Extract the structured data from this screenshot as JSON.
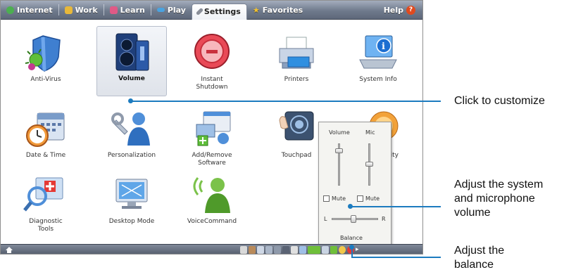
{
  "tabs": [
    {
      "label": "Internet",
      "color": "#4caf50"
    },
    {
      "label": "Work",
      "color": "#e8b83a"
    },
    {
      "label": "Learn",
      "color": "#e05a86"
    },
    {
      "label": "Play",
      "color": "#4aa3e0"
    },
    {
      "label": "Settings",
      "color": "#8a8f99",
      "active": true
    },
    {
      "label": "Favorites",
      "color": "#f4c430"
    }
  ],
  "help_label": "Help",
  "apps": [
    {
      "label": "Anti-Virus",
      "icon": "shield-icon"
    },
    {
      "label": "Volume",
      "icon": "speaker-icon",
      "selected": true
    },
    {
      "label": "Instant\nShutdown",
      "icon": "power-icon"
    },
    {
      "label": "Printers",
      "icon": "printer-icon"
    },
    {
      "label": "System Info",
      "icon": "laptop-info-icon"
    },
    {
      "label": "Date & Time",
      "icon": "clock-calendar-icon"
    },
    {
      "label": "Personalization",
      "icon": "user-wrench-icon"
    },
    {
      "label": "Add/Remove\nSoftware",
      "icon": "software-icon"
    },
    {
      "label": "Touchpad",
      "icon": "touchpad-icon"
    },
    {
      "label": "lity",
      "icon": "accessibility-icon"
    },
    {
      "label": "Diagnostic\nTools",
      "icon": "diagnostic-icon"
    },
    {
      "label": "Desktop Mode",
      "icon": "desktop-icon"
    },
    {
      "label": "VoiceCommand",
      "icon": "voice-icon"
    }
  ],
  "mixer": {
    "volume_label": "Volume",
    "mic_label": "Mic",
    "mute_label_1": "Mute",
    "mute_label_2": "Mute",
    "balance_left": "L",
    "balance_right": "R",
    "balance_label": "Balance"
  },
  "callouts": {
    "customize": "Click to customize",
    "adjust_volume": "Adjust the system\nand microphone\nvolume",
    "adjust_balance": "Adjust the\nbalance"
  },
  "colors": {
    "accent": "#1c7bbf"
  }
}
